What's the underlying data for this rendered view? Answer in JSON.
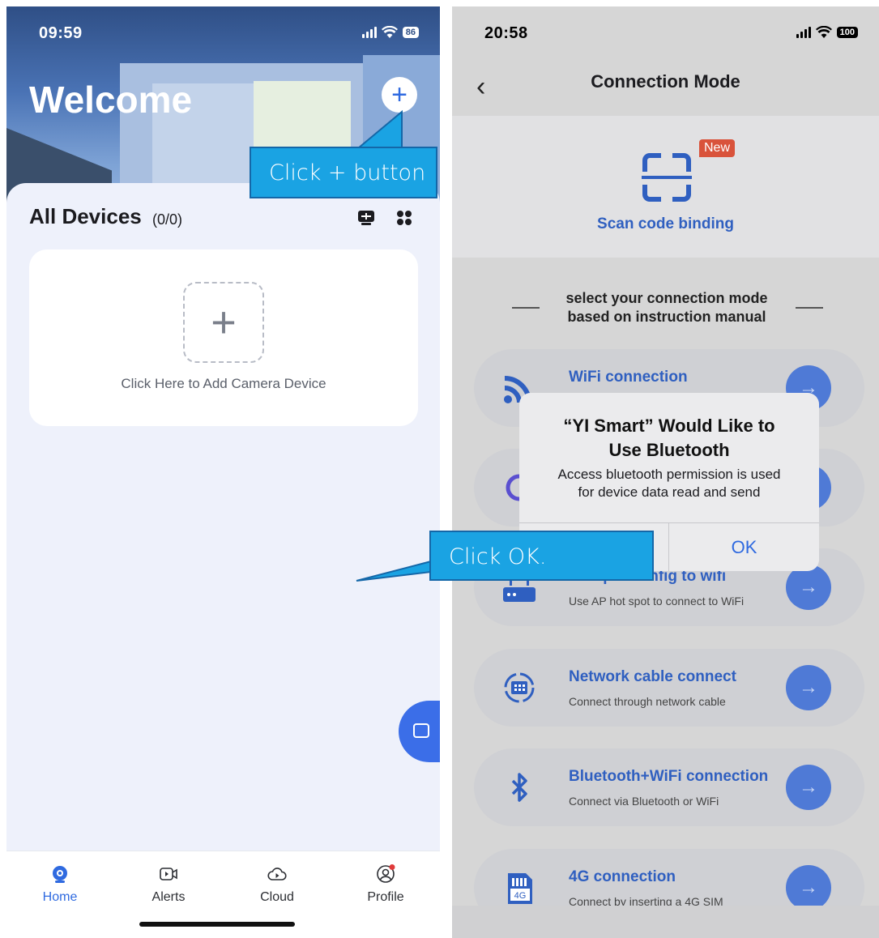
{
  "left_screen": {
    "status": {
      "time": "09:59",
      "battery": "86"
    },
    "header": {
      "title": "Welcome",
      "add_button_icon": "plus-icon"
    },
    "devices": {
      "title": "All Devices",
      "count": "(0/0)",
      "view_icons": [
        "monitor-view-icon",
        "grid-view-icon"
      ]
    },
    "add_card": {
      "label": "Click Here to Add Camera Device"
    },
    "chat_fab_icon": "chat-icon",
    "tabs": [
      {
        "label": "Home",
        "icon": "home-camera-icon",
        "active": true
      },
      {
        "label": "Alerts",
        "icon": "video-alerts-icon",
        "active": false
      },
      {
        "label": "Cloud",
        "icon": "cloud-play-icon",
        "active": false
      },
      {
        "label": "Profile",
        "icon": "profile-icon",
        "active": false
      }
    ]
  },
  "right_screen": {
    "status": {
      "time": "20:58",
      "battery": "100"
    },
    "nav": {
      "title": "Connection Mode",
      "back_icon": "chevron-left-icon"
    },
    "scan": {
      "badge": "New",
      "label": "Scan code binding",
      "icon": "scan-frame-icon"
    },
    "instruction": {
      "line1": "select your connection mode",
      "line2": "based on instruction manual"
    },
    "modes": [
      {
        "title": "WiFi connection",
        "subtitle": "",
        "icon": "wifi-icon"
      },
      {
        "title": "",
        "subtitle": "",
        "icon": "sound-wave-icon"
      },
      {
        "title": "Hotspot config to wifi",
        "subtitle": "Use AP hot spot to connect to WiFi",
        "icon": "router-icon"
      },
      {
        "title": "Network cable connect",
        "subtitle": "Connect through network cable",
        "icon": "network-cable-icon"
      },
      {
        "title": "Bluetooth+WiFi connection",
        "subtitle": "Connect via Bluetooth or WiFi",
        "icon": "bluetooth-icon"
      },
      {
        "title": "4G connection",
        "subtitle": "Connect by inserting a 4G SIM",
        "icon": "sim-4g-icon"
      }
    ],
    "dialog": {
      "title_line1": "“YI Smart” Would Like to",
      "title_line2": "Use Bluetooth",
      "message_line1": "Access bluetooth permission is used",
      "message_line2": "for device data read and send",
      "ok_label": "OK"
    }
  },
  "callouts": {
    "plus_hint": "Click + button",
    "ok_hint": "Click OK."
  },
  "colors": {
    "accent": "#2f6ae0",
    "callout_fill": "#1aa3e3",
    "callout_border": "#1467a8",
    "mode_link": "#2f5fc0",
    "new_badge": "#d9533b"
  }
}
